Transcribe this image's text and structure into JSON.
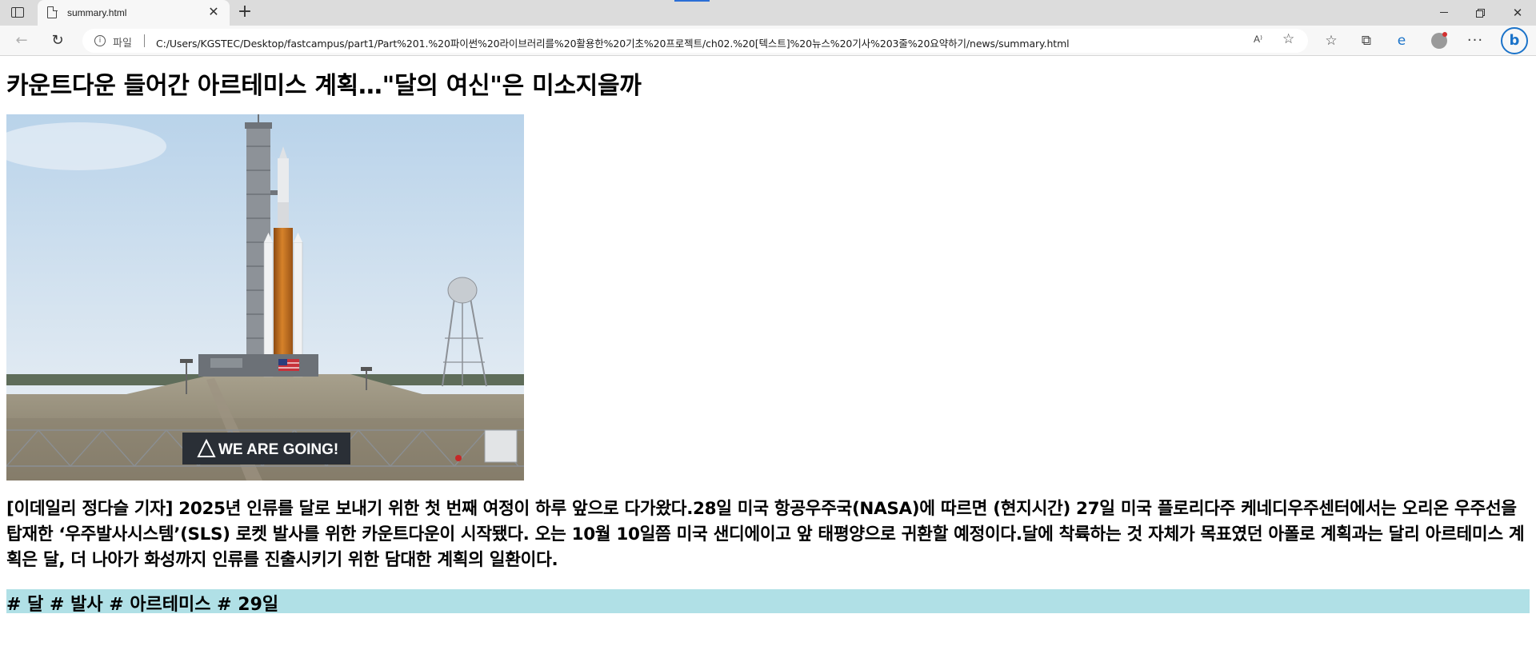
{
  "browser": {
    "tab": {
      "title": "summary.html",
      "icon": "document-icon",
      "close_glyph": "✕"
    },
    "new_tab_glyph": "+",
    "window_controls": {
      "minimize": "minimize-icon",
      "maximize": "restore-icon",
      "close_glyph": "✕"
    },
    "nav": {
      "back_glyph": "←",
      "reload_glyph": "↻"
    },
    "address_bar": {
      "scheme_label": "파일",
      "url": "C:/Users/KGSTEC/Desktop/fastcampus/part1/Part%201.%20파이썬%20라이브러리를%20활용한%20기초%20프로젝트/ch02.%20[텍스트]%20뉴스%20기사%203줄%20요약하기/news/summary.html",
      "read_aloud_glyph": "A⁾",
      "add_favorite_glyph": "☆"
    },
    "toolbar_icons": {
      "favorites_glyph": "☆",
      "collections_glyph": "⧉",
      "edge_glyph": "e",
      "more_glyph": "···",
      "bing_glyph": "b"
    }
  },
  "article": {
    "title": "카운트다운 들어간 아르테미스 계획…\"달의 여신\"은 미소지을까",
    "image": {
      "banner_text": "WE ARE GOING!"
    },
    "body": "[이데일리 정다슬 기자] 2025년 인류를 달로 보내기 위한 첫 번째 여정이 하루 앞으로 다가왔다.28일 미국 항공우주국(NASA)에 따르면 (현지시간) 27일 미국 플로리다주 케네디우주센터에서는 오리온 우주선을 탑재한 ‘우주발사시스템’(SLS) 로켓 발사를 위한 카운트다운이 시작됐다. 오는 10월 10일쯤 미국 샌디에이고 앞 태평양으로 귀환할 예정이다.달에 착륙하는 것 자체가 목표였던 아폴로 계획과는 달리 아르테미스 계획은 달, 더 나아가 화성까지 인류를 진출시키기 위한 담대한 계획의 일환이다.",
    "tags": "# 달 # 발사 # 아르테미스 # 29일",
    "tags_background": "#b0e0e6"
  }
}
